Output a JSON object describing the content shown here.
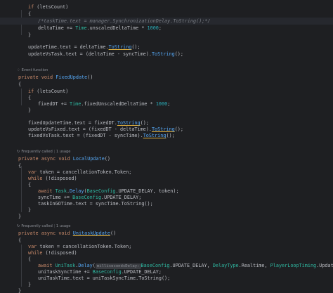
{
  "editor": {
    "hints": {
      "event_function": "Event function",
      "frequently_called": "Frequently called",
      "usage": "1 usage",
      "separator": "|"
    },
    "tokens": {
      "if": "if",
      "while": "while",
      "private": "private",
      "async": "async",
      "void": "void",
      "var": "var",
      "await": "await",
      "letsCount": "(letsCount)",
      "open_brace": "{",
      "close_brace": "}",
      "comment": "/*taskTime.text = manager.SynchronizationDelay.ToString();*/",
      "deltaTime": "deltaTime",
      "pluseq": " += ",
      "Time": "Time",
      "unscaledDeltaTime": ".unscaledDeltaTime * ",
      "n1000": "1000",
      "semi": ";",
      "updateTime_text": "updateTime.text = deltaTime.",
      "ToString": "ToString",
      "call_end": "();",
      "updateVsTask_text": "updateVsTask.text = (deltaTime - syncTime).",
      "FixedUpdate": "FixedUpdate",
      "parens": "()",
      "fixedDT": "fixedDT",
      "fixedUnscaledDeltaTime": ".fixedUnscaledDeltaTime * ",
      "fixedUpdateTime_text": "fixedUpdateTime.text = fixedDT.",
      "updateVsFixed_text": "updateVsFixed.text = (fixedDT - deltaTime).",
      "fixedVsTask_text": "fixedVsTask.text = (fixedDT - syncTime).",
      "LocalUpdate": "LocalUpdate",
      "token_decl": " token = cancellationToken.Token;",
      "while_cond": " (!disposed)",
      "Task": "Task",
      "Delay": "Delay",
      "open_paren": "(",
      "BaseConfig": "BaseConfig",
      "UPDATE_DELAY_token": ".UPDATE_DELAY, token);",
      "syncTime": "syncTime",
      "UPDATE_DELAY_end": ".UPDATE_DELAY;",
      "taskInGOTime_text": "taskInGOTime.text = syncTime.ToString();",
      "UnitaskUpdate": "UnitaskUpdate",
      "UniTask": "UniTask",
      "param_hint": "millisecondsDelay:",
      "UPDATE_DELAY_comma": ".UPDATE_DELAY, ",
      "DelayType": "DelayType",
      "Realtime": ".Realtime, ",
      "PlayerLoopTiming": "PlayerLoopTiming",
      "Update_token": ".Update, token);",
      "uniTaskSyncTime": "uniTaskSyncTime",
      "uniTaskTime_text": "uniTaskTime.text = uniTaskSyncTime.ToString();"
    }
  }
}
